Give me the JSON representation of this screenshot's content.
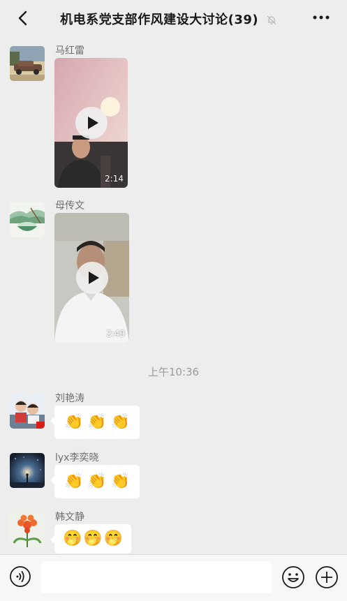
{
  "header": {
    "back_icon": "chevron-left-icon",
    "title": "机电系党支部作风建设大讨论(39)",
    "mute_icon": "bell-off-icon",
    "more_icon": "ellipsis-icon"
  },
  "messages": [
    {
      "type": "video",
      "sender": "马红雷",
      "duration": "2:14",
      "avatar_icon": "car-photo-avatar"
    },
    {
      "type": "video",
      "sender": "母传文",
      "duration": "2:49",
      "avatar_icon": "bowl-landscape-avatar"
    },
    {
      "type": "emoji",
      "sender": "刘艳涛",
      "emojis": [
        "👏",
        "👏",
        "👏"
      ],
      "avatar_icon": "children-photo-avatar"
    },
    {
      "type": "emoji",
      "sender": "lyx李奕晓",
      "emojis": [
        "👏",
        "👏",
        "👏"
      ],
      "avatar_icon": "starry-sky-avatar"
    },
    {
      "type": "emoji",
      "sender": "韩文静",
      "emojis": [
        "🤭",
        "🤭",
        "🤭"
      ],
      "avatar_icon": "flower-avatar"
    }
  ],
  "timestamp": "上午10:36",
  "composer": {
    "voice_icon": "voice-icon",
    "input_value": "",
    "emoji_icon": "smiley-icon",
    "plus_icon": "plus-circle-icon"
  }
}
